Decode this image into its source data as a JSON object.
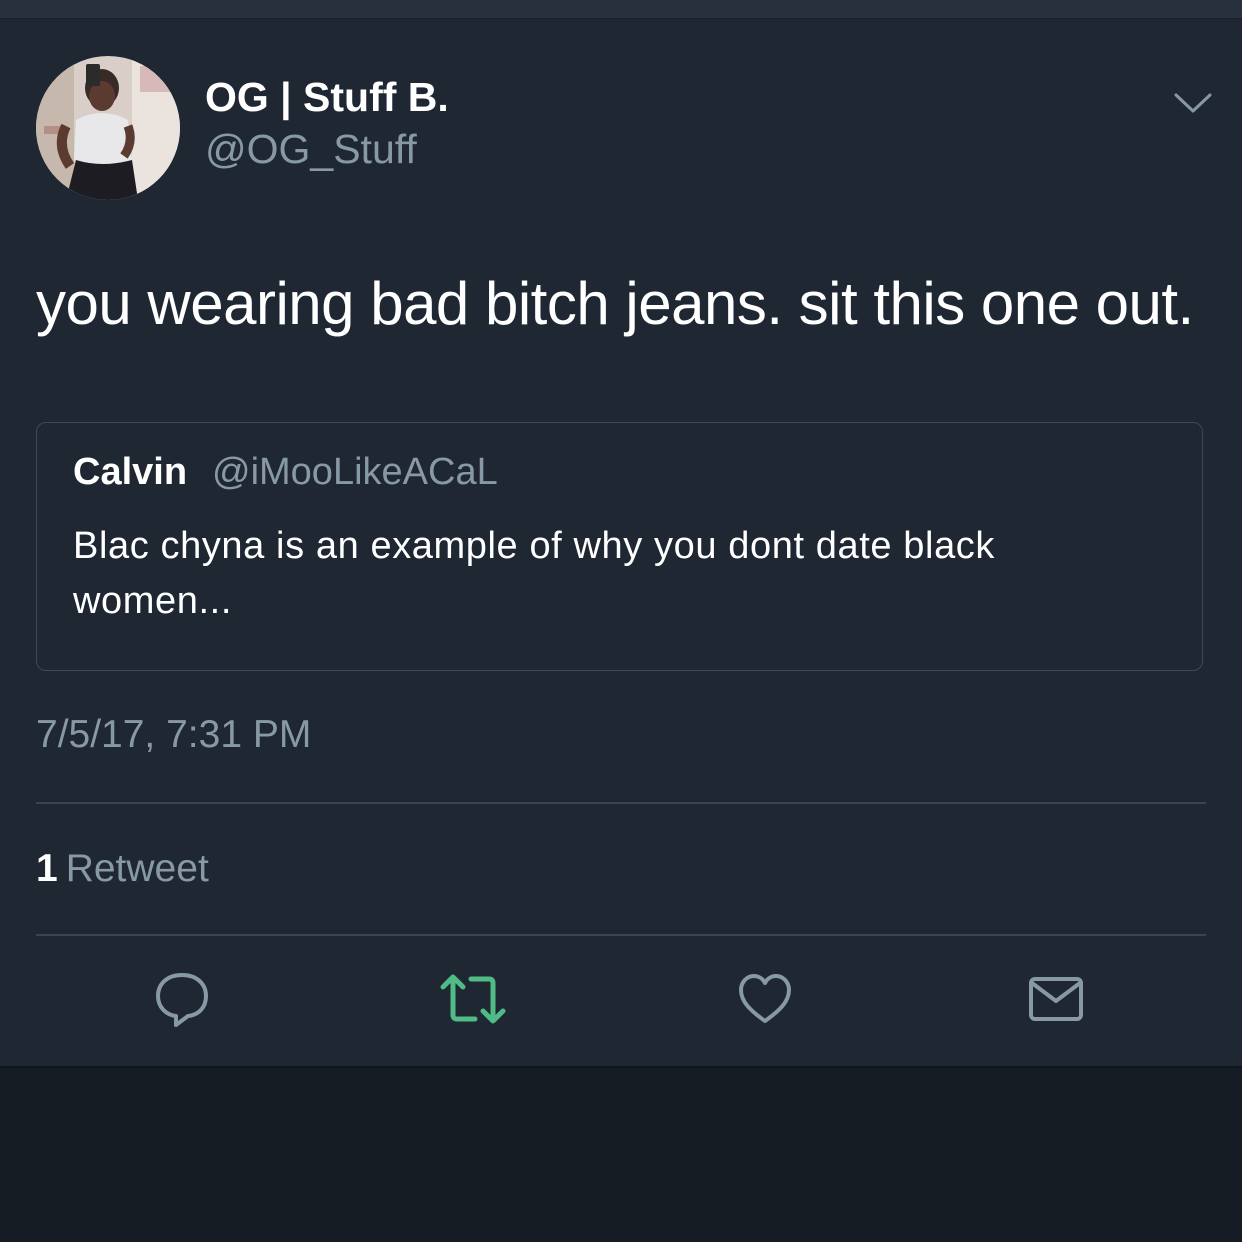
{
  "author": {
    "display_name": "OG | Stuff B.",
    "handle": "@OG_Stuff"
  },
  "tweet": {
    "text": "you wearing bad bitch jeans. sit this one out.",
    "timestamp": "7/5/17, 7:31 PM",
    "retweet_count": "1",
    "retweet_label": "Retweet"
  },
  "quoted_tweet": {
    "name": "Calvin",
    "handle": "@iMooLikeACaL",
    "text": "Blac chyna is an example of why you dont date black women..."
  },
  "actions": [
    {
      "icon": "reply-icon"
    },
    {
      "icon": "retweet-icon",
      "active_color": "#4fbb85"
    },
    {
      "icon": "like-icon"
    },
    {
      "icon": "direct-message-icon"
    }
  ],
  "colors": {
    "background": "#1f2733",
    "secondary_text": "#8899a6",
    "primary_text": "#ffffff",
    "retweet_active": "#4fbb85"
  }
}
